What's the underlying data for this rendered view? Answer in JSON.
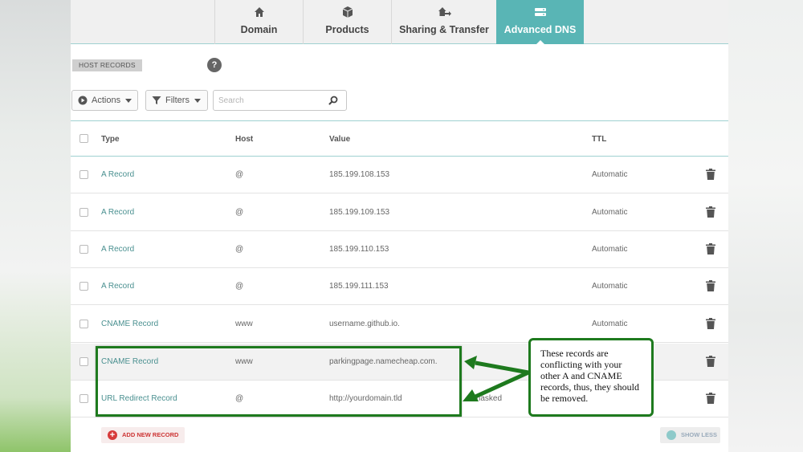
{
  "tabs": [
    {
      "label": "Domain",
      "icon": "home-icon",
      "active": false
    },
    {
      "label": "Products",
      "icon": "box-icon",
      "active": false
    },
    {
      "label": "Sharing & Transfer",
      "icon": "transfer-icon",
      "active": false
    },
    {
      "label": "Advanced DNS",
      "icon": "dns-icon",
      "active": true
    }
  ],
  "section": {
    "title": "HOST RECORDS",
    "help": "?"
  },
  "toolbar": {
    "actions_label": "Actions",
    "filters_label": "Filters",
    "search_placeholder": "Search"
  },
  "table": {
    "headers": {
      "type": "Type",
      "host": "Host",
      "value": "Value",
      "ttl": "TTL"
    },
    "rows": [
      {
        "type": "A Record",
        "host": "@",
        "value": "185.199.108.153",
        "ttl": "Automatic"
      },
      {
        "type": "A Record",
        "host": "@",
        "value": "185.199.109.153",
        "ttl": "Automatic"
      },
      {
        "type": "A Record",
        "host": "@",
        "value": "185.199.110.153",
        "ttl": "Automatic"
      },
      {
        "type": "A Record",
        "host": "@",
        "value": "185.199.111.153",
        "ttl": "Automatic"
      },
      {
        "type": "CNAME Record",
        "host": "www",
        "value": "username.github.io.",
        "ttl": "Automatic"
      },
      {
        "type": "CNAME Record",
        "host": "www",
        "value": "parkingpage.namecheap.com.",
        "ttl": ""
      },
      {
        "type": "URL Redirect Record",
        "host": "@",
        "value": "http://yourdomain.tld",
        "ttl": "masked"
      }
    ]
  },
  "footer": {
    "add_label": "ADD NEW RECORD",
    "show_less_label": "SHOW LESS"
  },
  "annotation": {
    "text": "These records are conflicting with your other A and CNAME records, thus, they should be removed.",
    "color": "#1e7a1e"
  },
  "colors": {
    "accent": "#59b5b5",
    "link": "#4a9090",
    "danger": "#d73a3a"
  }
}
